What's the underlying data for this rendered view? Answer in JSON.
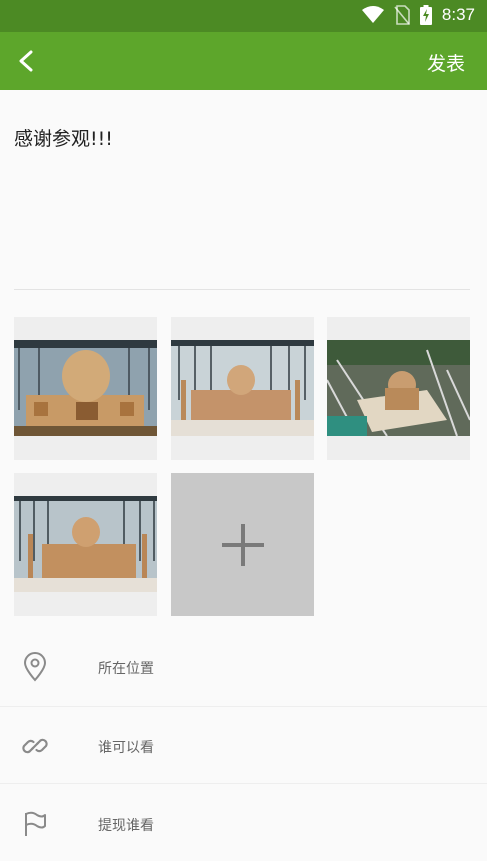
{
  "status_bar": {
    "time": "8:37"
  },
  "toolbar": {
    "publish_label": "发表"
  },
  "post": {
    "text": "感谢参观!!!"
  },
  "photos": [
    {
      "name": "photo-1"
    },
    {
      "name": "photo-2"
    },
    {
      "name": "photo-3"
    },
    {
      "name": "photo-4"
    }
  ],
  "options": {
    "location_label": "所在位置",
    "visibility_label": "谁可以看",
    "mention_label": "提现谁看"
  },
  "colors": {
    "status_bar": "#4c8a24",
    "toolbar": "#5da62b",
    "add_tile": "#c8c8c8"
  }
}
